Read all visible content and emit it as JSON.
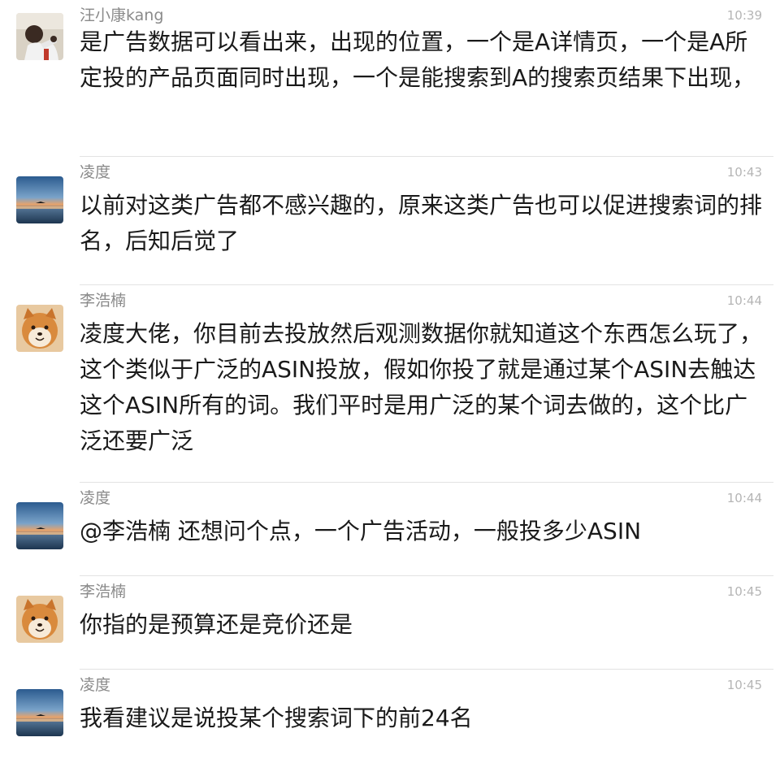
{
  "messages": [
    {
      "sender": "汪小康kang",
      "time": "10:39",
      "avatar": "person-photo",
      "text": "是广告数据可以看出来，出现的位置，一个是A详情页，一个是A所定投的产品页面同时出现，一个是能搜索到A的搜索页结果下出现，"
    },
    {
      "sender": "凌度",
      "time": "10:43",
      "avatar": "sunset-photo",
      "text": "以前对这类广告都不感兴趣的，原来这类广告也可以促进搜索词的排名，后知后觉了"
    },
    {
      "sender": "李浩楠",
      "time": "10:44",
      "avatar": "shiba-dog-photo",
      "text": "凌度大佬，你目前去投放然后观测数据你就知道这个东西怎么玩了，这个类似于广泛的ASIN投放，假如你投了就是通过某个ASIN去触达这个ASIN所有的词。我们平时是用广泛的某个词去做的，这个比广泛还要广泛"
    },
    {
      "sender": "凌度",
      "time": "10:44",
      "avatar": "sunset-photo",
      "text": "@李浩楠 还想问个点，一个广告活动，一般投多少ASIN"
    },
    {
      "sender": "李浩楠",
      "time": "10:45",
      "avatar": "shiba-dog-photo",
      "text": "你指的是预算还是竞价还是"
    },
    {
      "sender": "凌度",
      "time": "10:45",
      "avatar": "sunset-photo",
      "text": "我看建议是说投某个搜索词下的前24名"
    }
  ]
}
